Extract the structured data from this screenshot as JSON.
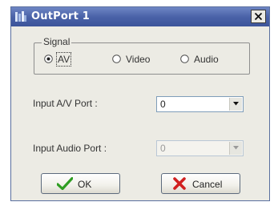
{
  "window": {
    "title": "OutPort 1"
  },
  "signal": {
    "group_label": "Signal",
    "options": [
      {
        "label": "AV",
        "selected": true
      },
      {
        "label": "Video",
        "selected": false
      },
      {
        "label": "Audio",
        "selected": false
      }
    ]
  },
  "fields": {
    "av_port": {
      "label": "Input A/V Port :",
      "value": "0",
      "enabled": true
    },
    "audio_port": {
      "label": "Input Audio Port :",
      "value": "0",
      "enabled": false
    }
  },
  "buttons": {
    "ok_label": "OK",
    "cancel_label": "Cancel"
  },
  "icons": {
    "app": "monitor-icon",
    "close": "close-icon",
    "ok": "checkmark-icon",
    "cancel": "x-cross-icon",
    "dropdown": "chevron-down-icon"
  },
  "colors": {
    "titlebar": "#4a62a8",
    "dialog_bg": "#ecebe4",
    "ok_icon": "#2f9d22",
    "cancel_icon": "#d12020"
  }
}
